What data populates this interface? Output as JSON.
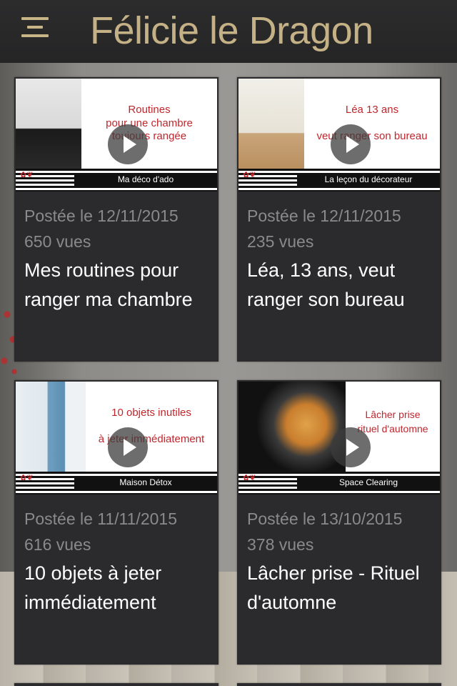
{
  "header": {
    "title": "Félicie le Dragon",
    "menu_icon": "hamburger-menu-icon",
    "title_color": "#c5b186"
  },
  "cards": [
    {
      "thumbnail": {
        "caption_lines": [
          "Routines",
          "pour une  chambre",
          "toujours rangée"
        ],
        "band": "Ma déco d'ado"
      },
      "date": "Postée le 12/11/2015",
      "views": "650 vues",
      "title": "Mes routines pour ranger ma chambre"
    },
    {
      "thumbnail": {
        "caption_lines": [
          "Léa 13 ans",
          "veut ranger son bureau"
        ],
        "band": "La leçon du décorateur"
      },
      "date": "Postée le 12/11/2015",
      "views": "235 vues",
      "title": "Léa, 13 ans, veut ranger son bureau"
    },
    {
      "thumbnail": {
        "caption_lines": [
          "10 objets inutiles",
          "à jeter immédiatement"
        ],
        "band": "Maison Détox"
      },
      "date": "Postée le 11/11/2015",
      "views": "616 vues",
      "title": "10 objets à jeter immédiatement"
    },
    {
      "thumbnail": {
        "caption_lines": [
          "Lâcher prise",
          "rituel d'automne"
        ],
        "band": "Space Clearing"
      },
      "date": "Postée le 13/10/2015",
      "views": "378 vues",
      "title": "Lâcher prise - Rituel d'automne"
    }
  ],
  "colors": {
    "card_bg": "#2b2b2d",
    "meta_text": "#8a8a8c",
    "thumb_caption": "#c0262c"
  }
}
